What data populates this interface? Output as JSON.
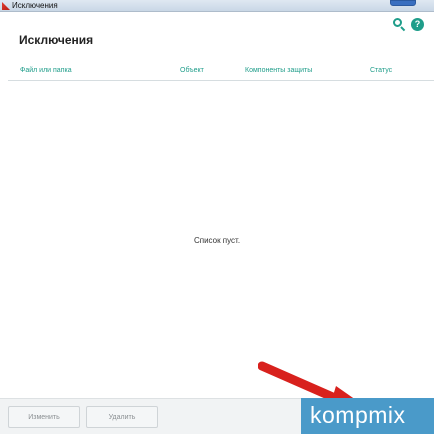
{
  "window": {
    "title": "Исключения"
  },
  "page": {
    "title": "Исключения"
  },
  "columns": [
    {
      "label": "Файл или папка"
    },
    {
      "label": "Объект"
    },
    {
      "label": "Компоненты защиты"
    },
    {
      "label": "Статус"
    }
  ],
  "list": {
    "empty_text": "Список пуст."
  },
  "buttons": {
    "edit": "Изменить",
    "delete": "Удалить"
  },
  "icons": {
    "search": "search-icon",
    "help": "help-icon",
    "help_glyph": "?"
  },
  "watermark": "kompmix",
  "colors": {
    "accent": "#1f9d8a",
    "arrow": "#d8211d",
    "watermark_bg": "#4a9ac9"
  }
}
